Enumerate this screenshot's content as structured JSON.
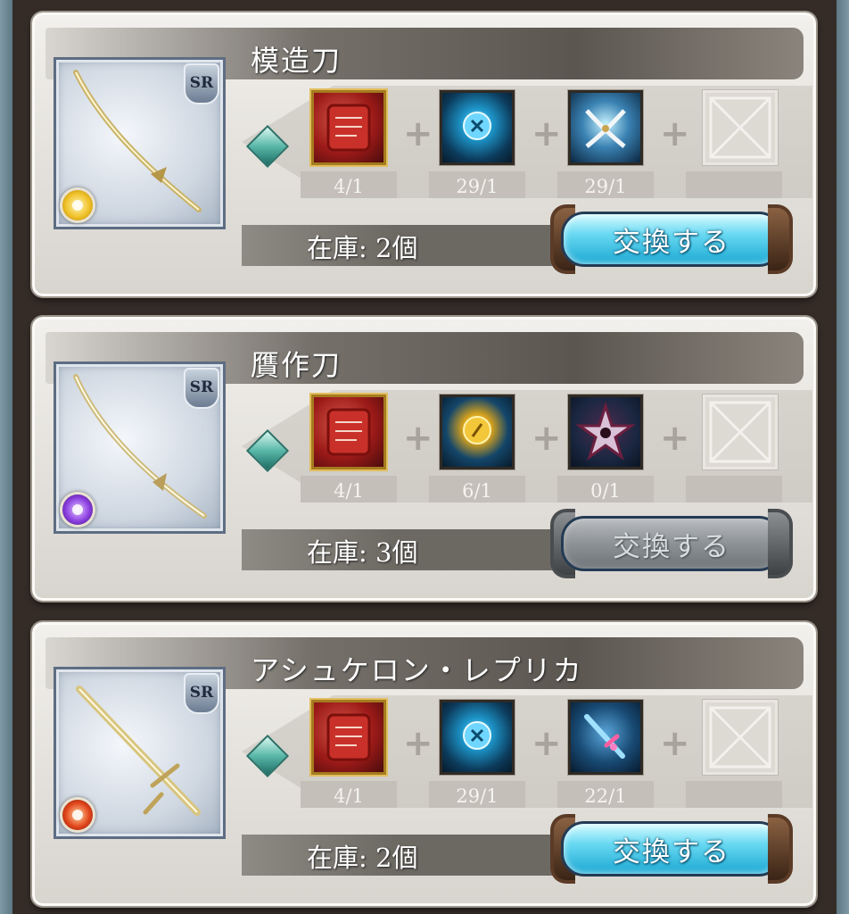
{
  "colors": {
    "button_active": "#1aa8d3",
    "button_disabled": "#8d9296",
    "card_bg": "#e6e3de"
  },
  "recipes": [
    {
      "name": "模造刀",
      "rarity": "SR",
      "element_icon": "light-element-icon",
      "stock": "在庫: 2個",
      "materials": [
        {
          "icon": "scroll-icon",
          "count": "4/1"
        },
        {
          "icon": "blue-orb-icon",
          "count": "29/1"
        },
        {
          "icon": "crossed-blades-icon",
          "count": "29/1"
        },
        {
          "icon": "empty-slot-icon",
          "count": ""
        }
      ],
      "button_label": "交換する",
      "button_state": "active"
    },
    {
      "name": "贋作刀",
      "rarity": "SR",
      "element_icon": "dark-element-icon",
      "stock": "在庫: 3個",
      "materials": [
        {
          "icon": "scroll-icon",
          "count": "4/1"
        },
        {
          "icon": "gold-orb-icon",
          "count": "6/1"
        },
        {
          "icon": "dark-star-icon",
          "count": "0/1"
        },
        {
          "icon": "empty-slot-icon",
          "count": ""
        }
      ],
      "button_label": "交換する",
      "button_state": "disabled"
    },
    {
      "name": "アシュケロン・レプリカ",
      "rarity": "SR",
      "element_icon": "fire-element-icon",
      "stock": "在庫: 2個",
      "materials": [
        {
          "icon": "scroll-icon",
          "count": "4/1"
        },
        {
          "icon": "blue-orb-icon",
          "count": "29/1"
        },
        {
          "icon": "crystal-sword-icon",
          "count": "22/1"
        },
        {
          "icon": "empty-slot-icon",
          "count": ""
        }
      ],
      "button_label": "交換する",
      "button_state": "active"
    }
  ]
}
